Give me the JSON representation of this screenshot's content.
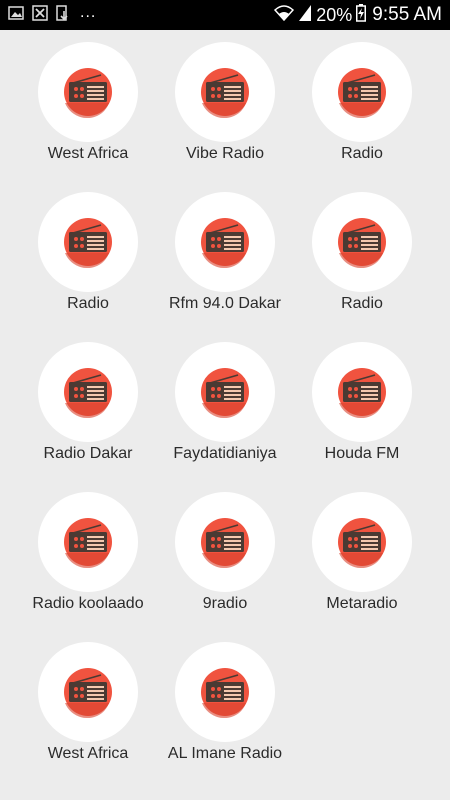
{
  "status_bar": {
    "icons_left": [
      "gallery-icon",
      "close-box-icon",
      "download-icon"
    ],
    "more": "...",
    "battery_percent": "20%",
    "time": "9:55 AM"
  },
  "colors": {
    "background": "#ececec",
    "icon_circle": "#f0533f",
    "radio_body": "#4b3a33"
  },
  "stations": [
    {
      "name": "West Africa"
    },
    {
      "name": "Vibe Radio"
    },
    {
      "name": "Radio"
    },
    {
      "name": "Radio"
    },
    {
      "name": "Rfm 94.0 Dakar"
    },
    {
      "name": "Radio"
    },
    {
      "name": "Radio Dakar"
    },
    {
      "name": "Faydatidianiya"
    },
    {
      "name": "Houda FM"
    },
    {
      "name": "Radio koolaado"
    },
    {
      "name": "9radio"
    },
    {
      "name": "Metaradio"
    },
    {
      "name": "West Africa"
    },
    {
      "name": "AL Imane Radio"
    }
  ]
}
